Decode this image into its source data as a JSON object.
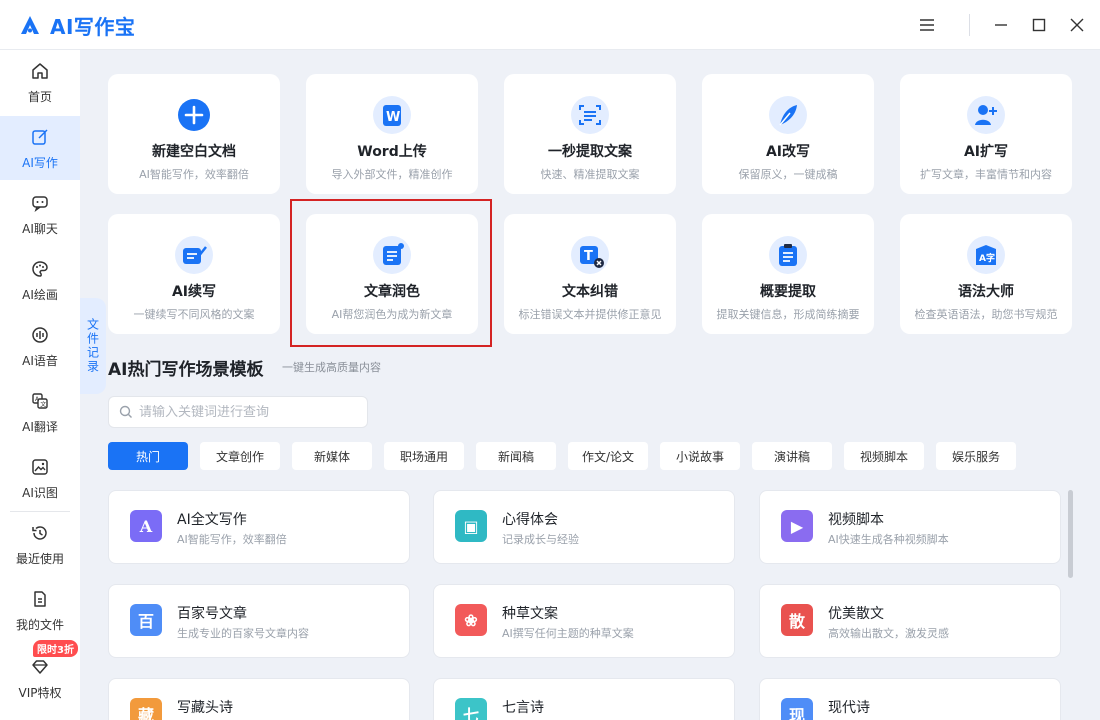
{
  "app": {
    "title": "AI写作宝",
    "brand_color": "#1a73f5"
  },
  "window_controls": [
    "menu-icon",
    "minimize-icon",
    "maximize-icon",
    "close-icon"
  ],
  "sidebar": {
    "items": [
      {
        "label": "首页",
        "icon": "home-icon",
        "active": false
      },
      {
        "label": "AI写作",
        "icon": "edit-icon",
        "active": true
      },
      {
        "label": "AI聊天",
        "icon": "chat-icon",
        "active": false
      },
      {
        "label": "AI绘画",
        "icon": "palette-icon",
        "active": false
      },
      {
        "label": "AI语音",
        "icon": "voice-icon",
        "active": false
      },
      {
        "label": "AI翻译",
        "icon": "translate-icon",
        "active": false
      },
      {
        "label": "AI识图",
        "icon": "image-recognize-icon",
        "active": false
      },
      {
        "label": "最近使用",
        "icon": "history-icon",
        "active": false
      },
      {
        "label": "我的文件",
        "icon": "file-icon",
        "active": false
      },
      {
        "label": "VIP特权",
        "icon": "vip-diamond-icon",
        "active": false
      }
    ],
    "vip_badge": "限时3折"
  },
  "file_record_tab": {
    "label": "文件记录"
  },
  "tools": [
    {
      "title": "新建空白文档",
      "desc": "AI智能写作，效率翻倍",
      "icon": "plus-icon"
    },
    {
      "title": "Word上传",
      "desc": "导入外部文件，精准创作",
      "icon": "word-icon"
    },
    {
      "title": "一秒提取文案",
      "desc": "快速、精准提取文案",
      "icon": "scan-text-icon"
    },
    {
      "title": "AI改写",
      "desc": "保留原义，一键成稿",
      "icon": "feather-icon"
    },
    {
      "title": "AI扩写",
      "desc": "扩写文章，丰富情节和内容",
      "icon": "expand-icon"
    },
    {
      "title": "AI续写",
      "desc": "一键续写不同风格的文案",
      "icon": "continue-write-icon"
    },
    {
      "title": "文章润色",
      "desc": "AI帮您润色为成为新文章",
      "icon": "polish-icon"
    },
    {
      "title": "文本纠错",
      "desc": "标注错误文本并提供修正意见",
      "icon": "text-correct-icon"
    },
    {
      "title": "概要提取",
      "desc": "提取关键信息，形成简练摘要",
      "icon": "summary-icon"
    },
    {
      "title": "语法大师",
      "desc": "检查英语语法，助您书写规范",
      "icon": "grammar-icon"
    }
  ],
  "section": {
    "title": "AI热门写作场景模板",
    "subtitle": "一键生成高质量内容"
  },
  "search": {
    "placeholder": "请输入关键词进行查询",
    "value": ""
  },
  "tags": [
    {
      "label": "热门",
      "active": true
    },
    {
      "label": "文章创作",
      "active": false
    },
    {
      "label": "新媒体",
      "active": false
    },
    {
      "label": "职场通用",
      "active": false
    },
    {
      "label": "新闻稿",
      "active": false
    },
    {
      "label": "作文/论文",
      "active": false
    },
    {
      "label": "小说故事",
      "active": false
    },
    {
      "label": "演讲稿",
      "active": false
    },
    {
      "label": "视频脚本",
      "active": false
    },
    {
      "label": "娱乐服务",
      "active": false
    }
  ],
  "templates": [
    {
      "name": "AI全文写作",
      "desc": "AI智能写作，效率翻倍",
      "icon": "ai-write-icon",
      "glyph": "A",
      "color": "#7b6cf6"
    },
    {
      "name": "心得体会",
      "desc": "记录成长与经验",
      "icon": "notebook-icon",
      "glyph": "▣",
      "color": "#2fb9c4"
    },
    {
      "name": "视频脚本",
      "desc": "AI快速生成各种视频脚本",
      "icon": "video-icon",
      "glyph": "▶",
      "color": "#8a6cf0"
    },
    {
      "name": "百家号文章",
      "desc": "生成专业的百家号文章内容",
      "icon": "baijia-icon",
      "glyph": "百",
      "color": "#4f8df7"
    },
    {
      "name": "种草文案",
      "desc": "AI撰写任何主题的种草文案",
      "icon": "sprout-icon",
      "glyph": "❀",
      "color": "#f25a5a"
    },
    {
      "name": "优美散文",
      "desc": "高效输出散文，激发灵感",
      "icon": "prose-icon",
      "glyph": "散",
      "color": "#e9524f"
    },
    {
      "name": "写藏头诗",
      "desc": "",
      "icon": "acrostic-icon",
      "glyph": "藏",
      "color": "#f29a3c"
    },
    {
      "name": "七言诗",
      "desc": "",
      "icon": "poem-icon",
      "glyph": "七",
      "color": "#3cc4c8"
    },
    {
      "name": "现代诗",
      "desc": "",
      "icon": "modern-poem-icon",
      "glyph": "现",
      "color": "#4f8df7"
    }
  ]
}
